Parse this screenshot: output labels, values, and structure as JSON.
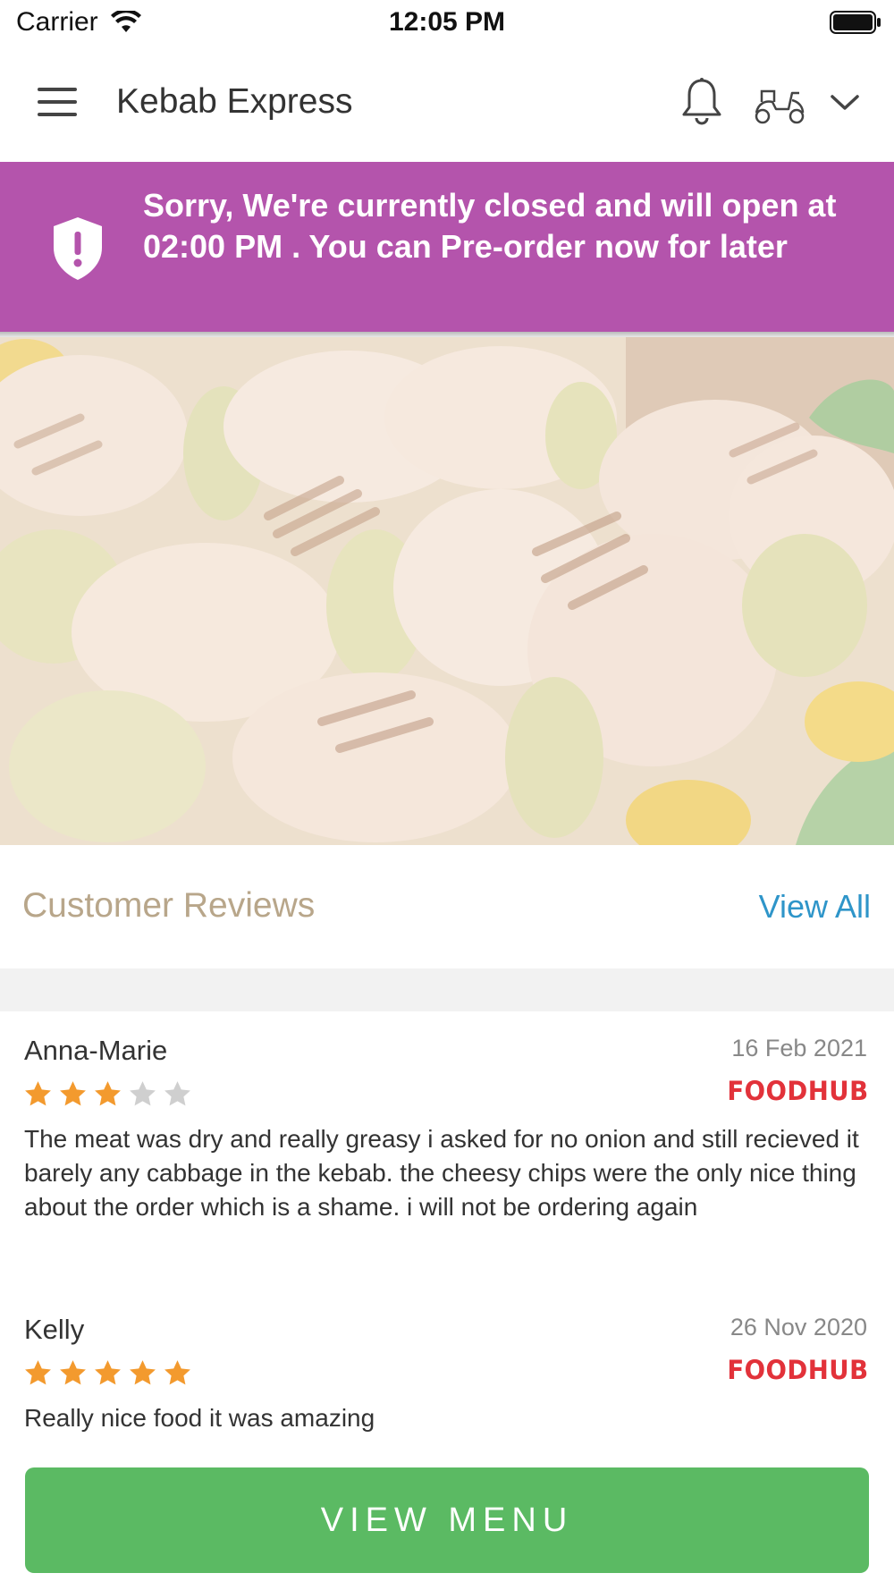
{
  "status_bar": {
    "carrier": "Carrier",
    "time": "12:05 PM"
  },
  "header": {
    "title": "Kebab Express",
    "icons": [
      "menu-icon",
      "bell-icon",
      "scooter-icon",
      "chevron-down-icon"
    ]
  },
  "banner": {
    "message": "Sorry, We're currently closed and will open at 02:00 PM . You can Pre-order now for later",
    "background_color": "#b454ac",
    "icon": "shield-alert-icon"
  },
  "hero": {
    "image": "grilled chicken skewers"
  },
  "reviews": {
    "title": "Customer Reviews",
    "view_all": "View All",
    "items": [
      {
        "name": "Anna-Marie",
        "date": "16 Feb 2021",
        "rating": 3,
        "max_rating": 5,
        "source": "FOODHUB",
        "text": "The meat was dry and really greasy i asked for no onion and still recieved it barely any cabbage in the kebab. the cheesy chips were the only nice thing about the order which is a shame. i will not be ordering again"
      },
      {
        "name": "Kelly",
        "date": "26 Nov 2020",
        "rating": 5,
        "max_rating": 5,
        "source": "FOODHUB",
        "text": "Really nice food it was amazing"
      }
    ]
  },
  "footer": {
    "button_label": "VIEW MENU",
    "button_color": "#5bba63"
  },
  "colors": {
    "star_filled": "#f39a2e",
    "star_empty": "#cfcfcf",
    "link": "#2e95c9",
    "reviews_title": "#b8a68a",
    "brand_red": "#e2323a"
  }
}
